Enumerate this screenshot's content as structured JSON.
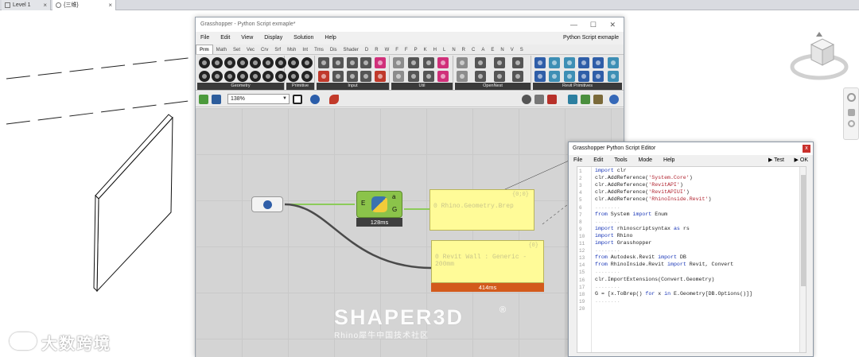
{
  "revit": {
    "tabs": [
      {
        "label": "Level 1",
        "close": "×"
      },
      {
        "label": "{三维}",
        "close": "×"
      }
    ]
  },
  "grasshopper": {
    "window_title": "Grasshopper - Python Script exmaple*",
    "window_controls": {
      "minimize": "—",
      "maximize": "☐",
      "close": "✕"
    },
    "menu": [
      "File",
      "Edit",
      "View",
      "Display",
      "Solution",
      "Help"
    ],
    "document_name": "Python Script exmaple",
    "category_tabs": [
      "Prm",
      "Math",
      "Set",
      "Vec",
      "Crv",
      "Srf",
      "Msh",
      "Int",
      "Trns",
      "Dis",
      "Shader",
      "D",
      "R",
      "W",
      "F",
      "F",
      "P",
      "K",
      "H",
      "L",
      "N",
      "R",
      "C",
      "A",
      "E",
      "N",
      "V",
      "S"
    ],
    "active_category": "Prm",
    "ribbon_groups": [
      "Geometry",
      "Primitive",
      "Input",
      "Util",
      "OpenNest",
      "Revit Primitives"
    ],
    "zoom": "138%",
    "components": {
      "python_inputs": {
        "E": "E"
      },
      "python_outputs": {
        "a": "a",
        "G": "G"
      },
      "python_time": "128ms",
      "panel1": {
        "corner": "{0;0}",
        "text": "0 Rhino.Geometry.Brep"
      },
      "panel2": {
        "corner": "{0}",
        "text": "0 Revit Wall : Generic - 200mm"
      },
      "panel2_time": "414ms"
    }
  },
  "python_editor": {
    "title": "Grasshopper Python Script Editor",
    "close": "x",
    "menu": [
      "File",
      "Edit",
      "Tools",
      "Mode",
      "Help"
    ],
    "test_label": "Test",
    "ok_label": "OK",
    "line_numbers": [
      "1",
      "2",
      "3",
      "4",
      "5",
      "6",
      "7",
      "8",
      "9",
      "10",
      "11",
      "12",
      "13",
      "14",
      "15",
      "16",
      "17",
      "18",
      "19",
      "20"
    ],
    "code_lines": [
      "import clr",
      "clr.AddReference('System.Core')",
      "clr.AddReference('RevitAPI')",
      "clr.AddReference('RevitAPIUI')",
      "clr.AddReference('RhinoInside.Revit')",
      "........",
      "from System import Enum",
      "........",
      "import rhinoscriptsyntax as rs",
      "import Rhino",
      "import Grasshopper",
      "........",
      "from Autodesk.Revit import DB",
      "from RhinoInside.Revit import Revit, Convert",
      "........",
      "clr.ImportExtensions(Convert.Geometry)",
      "........",
      "G = [x.ToBrep() for x in E.Geometry[DB.Options()]]",
      "........",
      ""
    ]
  },
  "watermark": {
    "logo": "SHAPER3D",
    "registered": "®",
    "subtitle": "Rhino犀牛中国技术社区",
    "left_mark": "大数跨境"
  },
  "colors": {
    "canvas": "#d4d4d4",
    "panel": "#fffb98",
    "python_comp": "#7ab648",
    "timer_ok": "#404040",
    "timer_slow": "#d35a1c",
    "keyword": "#1a37b8",
    "string": "#b0222e"
  }
}
